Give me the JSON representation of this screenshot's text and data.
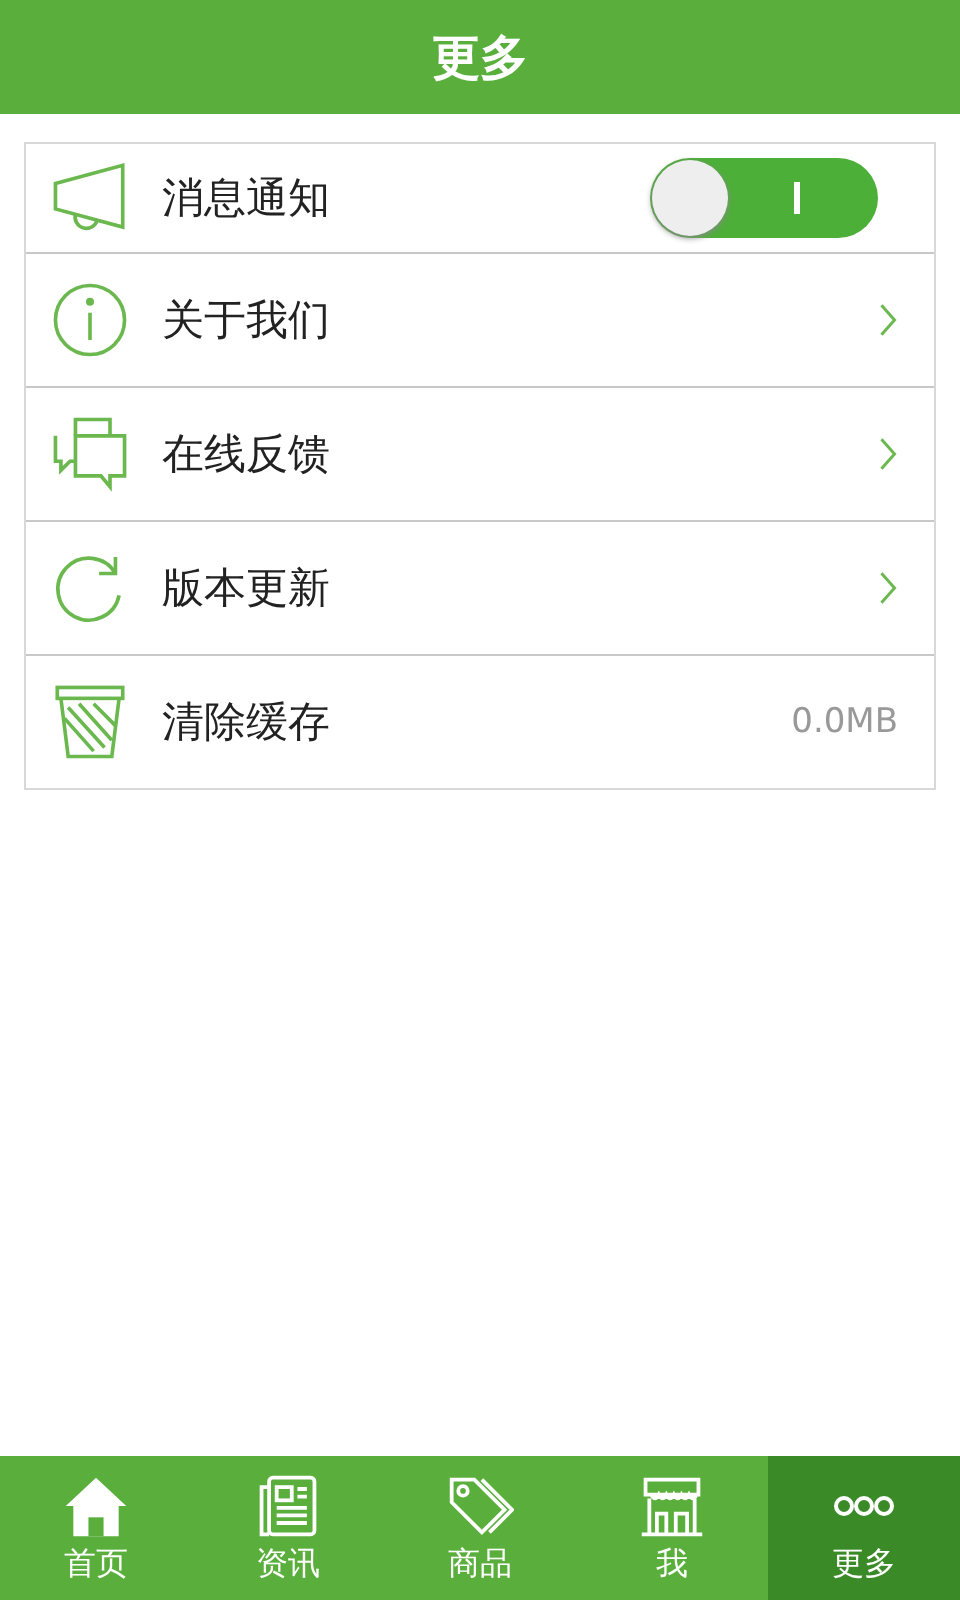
{
  "header": {
    "title": "更多"
  },
  "settings": [
    {
      "kind": "toggle",
      "label": "消息通知",
      "on": true
    },
    {
      "kind": "link",
      "label": "关于我们"
    },
    {
      "kind": "link",
      "label": "在线反馈"
    },
    {
      "kind": "link",
      "label": "版本更新"
    },
    {
      "kind": "value",
      "label": "清除缓存",
      "value": "0.0MB"
    }
  ],
  "tabs": [
    {
      "label": "首页",
      "selected": false
    },
    {
      "label": "资讯",
      "selected": false
    },
    {
      "label": "商品",
      "selected": false
    },
    {
      "label": "我",
      "selected": false
    },
    {
      "label": "更多",
      "selected": true
    }
  ]
}
